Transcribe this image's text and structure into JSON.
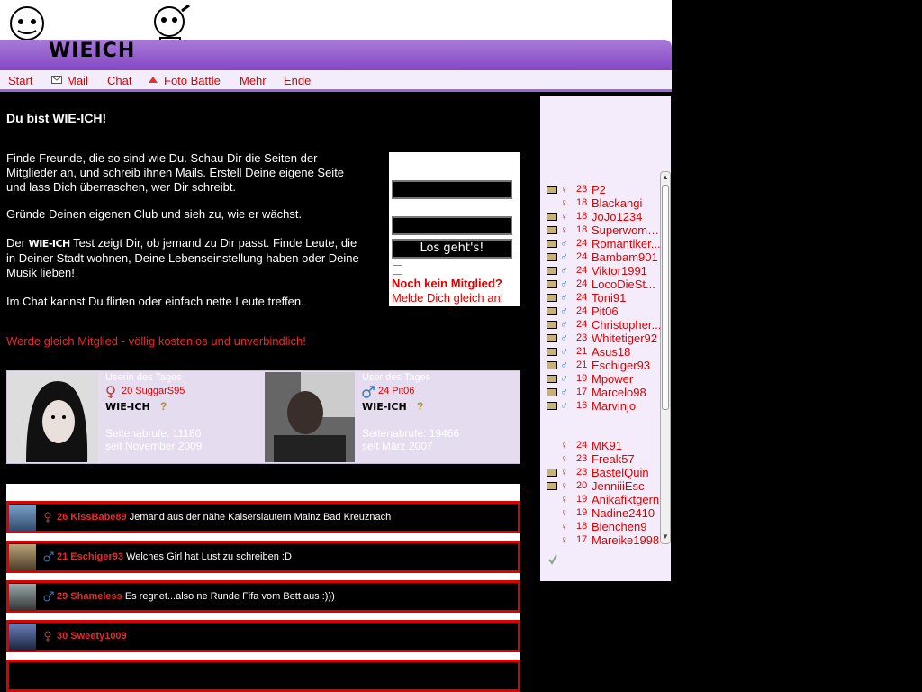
{
  "logo": {
    "text_a": "WIE",
    "text_b": "ICH"
  },
  "nav": [
    {
      "label": "Start"
    },
    {
      "label": "Mail"
    },
    {
      "label": "Chat"
    },
    {
      "label": "Foto Battle"
    },
    {
      "label": "Mehr"
    },
    {
      "label": "Ende"
    }
  ],
  "main": {
    "headline": "Du bist WIE-ICH!",
    "para1": "Finde Freunde, die so sind wie Du. Schau Dir die Seiten der Mitglieder an, und schreib ihnen Mails. Erstell Deine eigene Seite und lass Dich überraschen, wer Dir schreibt.",
    "para2": "Gründe Deinen eigenen Club und sieh zu, wie er wächst.",
    "para3_prefix": "Der",
    "para3_logo": "WIE-ICH",
    "para3": "Test zeigt Dir, ob jemand zu Dir passt. Finde Leute, die in Deiner Stadt wohnen, Deine Lebenseinstellung haben oder Deine Musik lieben!",
    "para4": "Im Chat kannst Du flirten oder einfach nette Leute treffen.",
    "signup": "Werde gleich Mitglied - völlig kostenlos und unverbindlich!"
  },
  "login": {
    "submit": "Los geht's!",
    "no_member": "Noch kein Mitglied?",
    "join": "Melde Dich gleich an!"
  },
  "cards": [
    {
      "title": "Userin des Tages",
      "user": "20 SuggarS95",
      "gender_icon": "female-icon",
      "wie": "WIE-ICH",
      "views": "Seitenabrufe: 11180",
      "since": "seit November 2009"
    },
    {
      "title": "User des Tages",
      "user": "24 Pit06",
      "gender_icon": "male-icon",
      "wie": "WIE-ICH",
      "views": "Seitenabrufe: 19466",
      "since": "seit März 2007"
    }
  ],
  "feed": [
    {
      "user": "26 KissBabe89",
      "msg": "Jemand aus der nähe Kaiserslautern Mainz Bad Kreuznach",
      "gender": "female-icon"
    },
    {
      "user": "21 Eschiger93",
      "msg": "Welches Girl hat Lust zu schreiben :D",
      "gender": "male-icon"
    },
    {
      "user": "29 Shameless",
      "msg": "Es regnet...also ne Runde Fifa vom Bett aus :)))",
      "gender": "male-icon"
    },
    {
      "user": "30 Sweety1009",
      "msg": "",
      "gender": "female-icon"
    }
  ],
  "sidebar": {
    "online_list": [
      {
        "age": "23",
        "name": "P2",
        "cam": true,
        "gender": "female-icon"
      },
      {
        "age": "18",
        "name": "Blackangi",
        "cam": false,
        "gender": "female-icon"
      },
      {
        "age": "18",
        "name": "JoJo1234",
        "cam": true,
        "gender": "female-icon"
      },
      {
        "age": "18",
        "name": "Superwoma...",
        "cam": true,
        "gender": "female-icon"
      },
      {
        "age": "24",
        "name": "Romantiker...",
        "cam": true,
        "gender": "male-icon"
      },
      {
        "age": "24",
        "name": "Bambam901",
        "cam": true,
        "gender": "male-icon"
      },
      {
        "age": "24",
        "name": "Viktor1991",
        "cam": true,
        "gender": "male-icon"
      },
      {
        "age": "24",
        "name": "LocoDieSt...",
        "cam": true,
        "gender": "male-icon"
      },
      {
        "age": "24",
        "name": "Toni91",
        "cam": true,
        "gender": "male-icon"
      },
      {
        "age": "24",
        "name": "Pit06",
        "cam": true,
        "gender": "male-icon"
      },
      {
        "age": "24",
        "name": "Christopher...",
        "cam": true,
        "gender": "male-icon"
      },
      {
        "age": "23",
        "name": "Whitetiger92",
        "cam": true,
        "gender": "male-icon"
      },
      {
        "age": "21",
        "name": "Asus18",
        "cam": true,
        "gender": "male-icon"
      },
      {
        "age": "21",
        "name": "Eschiger93",
        "cam": true,
        "gender": "male-icon"
      },
      {
        "age": "19",
        "name": "Mpower",
        "cam": true,
        "gender": "male-icon"
      },
      {
        "age": "17",
        "name": "Marcelo98",
        "cam": true,
        "gender": "male-icon"
      },
      {
        "age": "16",
        "name": "Marvinjo",
        "cam": true,
        "gender": "male-icon"
      }
    ],
    "new_list": [
      {
        "age": "24",
        "name": "MK91",
        "cam": false,
        "gender": "female-icon"
      },
      {
        "age": "23",
        "name": "Freak57",
        "cam": false,
        "gender": "female-icon"
      },
      {
        "age": "23",
        "name": "BastelQuin",
        "cam": true,
        "gender": "female-icon"
      },
      {
        "age": "20",
        "name": "JenniiiEsc",
        "cam": true,
        "gender": "female-icon"
      },
      {
        "age": "19",
        "name": "Anikafiktgern",
        "cam": false,
        "gender": "female-icon"
      },
      {
        "age": "19",
        "name": "Nadine2410",
        "cam": false,
        "gender": "female-icon"
      },
      {
        "age": "18",
        "name": "Bienchen9",
        "cam": false,
        "gender": "female-icon"
      },
      {
        "age": "17",
        "name": "Mareike1998",
        "cam": false,
        "gender": "female-icon"
      }
    ]
  },
  "colors": {
    "accent": "#8447c6",
    "link": "#dd0000"
  }
}
